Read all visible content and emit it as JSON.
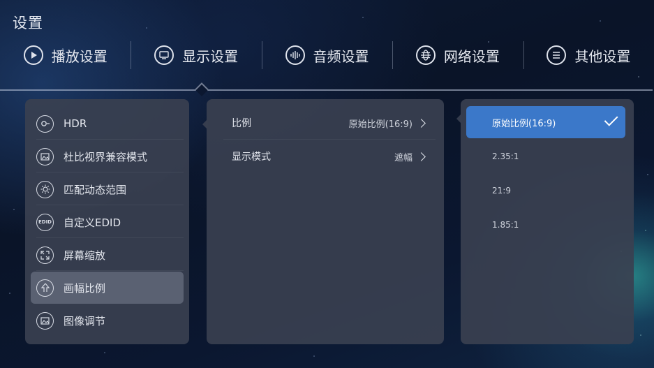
{
  "page": {
    "title": "设置"
  },
  "tabs": [
    {
      "label": "播放设置",
      "icon": "play-icon"
    },
    {
      "label": "显示设置",
      "icon": "display-icon"
    },
    {
      "label": "音频设置",
      "icon": "audio-wave-icon"
    },
    {
      "label": "网络设置",
      "icon": "globe-icon"
    },
    {
      "label": "其他设置",
      "icon": "menu-lines-icon"
    }
  ],
  "display_menu": {
    "items": [
      {
        "label": "HDR",
        "icon": "hdr-icon"
      },
      {
        "label": "杜比视界兼容模式",
        "icon": "image-icon"
      },
      {
        "label": "匹配动态范围",
        "icon": "brightness-icon"
      },
      {
        "label": "自定义EDID",
        "icon": "edid-icon",
        "icon_text": "EDID"
      },
      {
        "label": "屏幕缩放",
        "icon": "expand-icon"
      },
      {
        "label": "画幅比例",
        "icon": "aspect-icon",
        "active": true
      },
      {
        "label": "图像调节",
        "icon": "picture-adjust-icon"
      }
    ]
  },
  "aspect_settings": {
    "rows": [
      {
        "label": "比例",
        "value": "原始比例(16:9)"
      },
      {
        "label": "显示模式",
        "value": "遮幅"
      }
    ]
  },
  "ratio_options": {
    "items": [
      {
        "label": "原始比例(16:9)",
        "selected": true
      },
      {
        "label": "2.35:1"
      },
      {
        "label": "21:9"
      },
      {
        "label": "1.85:1"
      }
    ]
  },
  "colors": {
    "accent": "#3b78c9",
    "panel": "#3a4050"
  }
}
